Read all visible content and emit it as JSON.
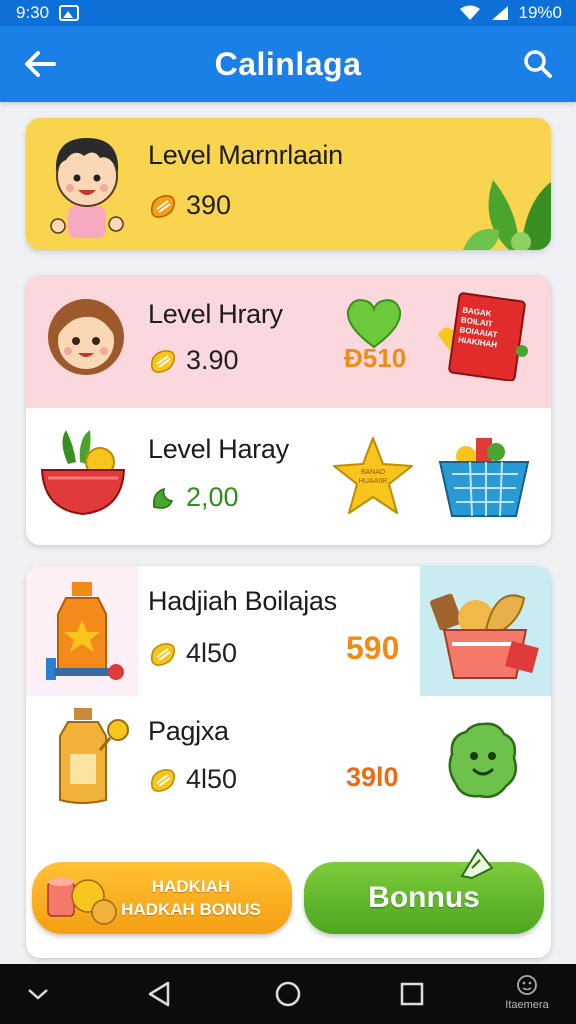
{
  "status_bar": {
    "time": "9:30",
    "battery": "19%0"
  },
  "app_bar": {
    "title": "Calinlaga"
  },
  "cards": {
    "first": {
      "label": "Level Marnrlaain",
      "value": "390"
    },
    "second": {
      "row1": {
        "label": "Level Hrary",
        "value": "3.90",
        "price": "Ð510"
      },
      "row2": {
        "label": "Level Haray",
        "value": "2,00"
      }
    },
    "third": {
      "row1": {
        "label": "Hadjiah Boilajas",
        "value": "4l50",
        "price": "590"
      },
      "row2": {
        "label": "Pagjxa",
        "value": "4l50",
        "price": "39l0"
      }
    }
  },
  "book_text": "BAGAK BOILAIT BOIAAIAT HIAKIHAH",
  "star_text": "BANAD HUAAIIR",
  "buttons": {
    "hadiah_label": "HADKIAH HADKAH BONUS",
    "bonus_label": "Bonnus"
  },
  "nav_bar": {
    "mini_label": "Itaemera"
  },
  "colors": {
    "app_bar": "#1a7fe6",
    "card_yellow": "#f9d44e",
    "row_pink": "#fbd7de",
    "price_orange": "#f08c14",
    "value_green": "#2f8f1a",
    "button_orange": "#f59f12",
    "button_green": "#4ea61f"
  },
  "icons": [
    "back-arrow-icon",
    "search-icon",
    "coin-icon",
    "heart-icon",
    "star-icon",
    "basket-icon",
    "book-icon",
    "bottle-icon",
    "gift-icon",
    "nav-back-icon",
    "nav-home-icon",
    "nav-recents-icon"
  ]
}
